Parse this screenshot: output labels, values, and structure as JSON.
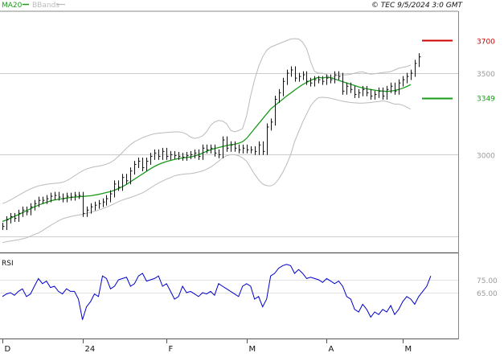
{
  "header": {
    "legend_ma": "MA20",
    "legend_bb": "BBands",
    "copyright": "© TEC 9/5/2024 3:0 GMT"
  },
  "colors": {
    "ma": "#1a9a1a",
    "bbands": "#bbbbbb",
    "rsi": "#0000cc",
    "price": "#111111",
    "target_high": "#cc0000",
    "target_low": "#1a9a1a",
    "grid": "#cccccc"
  },
  "chart_data": [
    {
      "type": "ohlc",
      "axis_ticks": [
        {
          "value": 3700,
          "label": "3700",
          "color": "#cc0000"
        },
        {
          "value": 3500,
          "label": "3500"
        },
        {
          "value": 3349,
          "label": "3349",
          "color": "#1a9a1a"
        },
        {
          "value": 3000,
          "label": "3000"
        }
      ],
      "grid_levels": [
        3500,
        3000,
        2500
      ],
      "ylim": [
        2400,
        3880
      ],
      "x_labels": [
        {
          "label": "D",
          "index": 0
        },
        {
          "label": "24",
          "index": 20
        },
        {
          "label": "F",
          "index": 41
        },
        {
          "label": "M",
          "index": 61
        },
        {
          "label": "A",
          "index": 81
        },
        {
          "label": "M",
          "index": 100
        }
      ],
      "series": [
        {
          "name": "MA20",
          "values": [
            2590,
            2600,
            2610,
            2622,
            2632,
            2644,
            2656,
            2668,
            2680,
            2690,
            2700,
            2708,
            2716,
            2722,
            2726,
            2730,
            2734,
            2738,
            2740,
            2742,
            2744,
            2746,
            2748,
            2752,
            2756,
            2762,
            2768,
            2774,
            2782,
            2792,
            2804,
            2818,
            2834,
            2850,
            2866,
            2882,
            2898,
            2914,
            2928,
            2940,
            2950,
            2958,
            2965,
            2971,
            2976,
            2980,
            2983,
            2986,
            2992,
            3000,
            3010,
            3020,
            3030,
            3038,
            3044,
            3050,
            3056,
            3060,
            3064,
            3070,
            3080,
            3100,
            3130,
            3160,
            3190,
            3220,
            3250,
            3280,
            3300,
            3320,
            3340,
            3360,
            3378,
            3396,
            3414,
            3430,
            3444,
            3456,
            3466,
            3475,
            3470,
            3476,
            3472,
            3464,
            3456,
            3448,
            3440,
            3432,
            3424,
            3416,
            3410,
            3404,
            3400,
            3396,
            3392,
            3390,
            3388,
            3390,
            3394,
            3400,
            3408,
            3418,
            3430
          ]
        },
        {
          "name": "BB Upper",
          "values": [
            2700,
            2710,
            2722,
            2736,
            2750,
            2764,
            2778,
            2790,
            2800,
            2808,
            2814,
            2818,
            2822,
            2824,
            2826,
            2830,
            2840,
            2854,
            2870,
            2886,
            2900,
            2912,
            2920,
            2926,
            2930,
            2935,
            2942,
            2952,
            2968,
            2990,
            3014,
            3040,
            3062,
            3080,
            3092,
            3104,
            3114,
            3122,
            3128,
            3132,
            3134,
            3136,
            3138,
            3140,
            3140,
            3136,
            3126,
            3108,
            3100,
            3104,
            3116,
            3140,
            3180,
            3200,
            3210,
            3206,
            3190,
            3150,
            3140,
            3148,
            3160,
            3240,
            3360,
            3460,
            3540,
            3600,
            3640,
            3660,
            3670,
            3680,
            3690,
            3700,
            3710,
            3712,
            3710,
            3690,
            3650,
            3570,
            3510,
            3500,
            3500,
            3490,
            3470,
            3480,
            3490,
            3490,
            3490,
            3494,
            3500,
            3506,
            3508,
            3500,
            3494,
            3496,
            3500,
            3504,
            3506,
            3510,
            3520,
            3530,
            3536,
            3540,
            3550
          ]
        },
        {
          "name": "BB Lower",
          "values": [
            2460,
            2466,
            2470,
            2474,
            2478,
            2484,
            2490,
            2500,
            2510,
            2520,
            2534,
            2550,
            2566,
            2580,
            2594,
            2606,
            2614,
            2620,
            2626,
            2630,
            2634,
            2640,
            2646,
            2652,
            2660,
            2668,
            2678,
            2688,
            2700,
            2712,
            2722,
            2730,
            2738,
            2746,
            2756,
            2766,
            2780,
            2796,
            2812,
            2826,
            2838,
            2850,
            2860,
            2870,
            2876,
            2880,
            2882,
            2884,
            2888,
            2894,
            2900,
            2910,
            2924,
            2940,
            2960,
            2980,
            2994,
            3000,
            3000,
            2994,
            2980,
            2960,
            2920,
            2880,
            2846,
            2820,
            2810,
            2808,
            2820,
            2850,
            2890,
            2940,
            3000,
            3080,
            3140,
            3200,
            3250,
            3300,
            3330,
            3350,
            3352,
            3350,
            3346,
            3340,
            3334,
            3328,
            3324,
            3320,
            3318,
            3316,
            3316,
            3318,
            3320,
            3324,
            3326,
            3330,
            3326,
            3318,
            3310,
            3310,
            3304,
            3292,
            3278
          ]
        },
        {
          "name": "Price",
          "values": [
            2560,
            2600,
            2620,
            2610,
            2640,
            2660,
            2650,
            2680,
            2700,
            2720,
            2720,
            2730,
            2745,
            2750,
            2740,
            2730,
            2745,
            2740,
            2750,
            2750,
            2640,
            2660,
            2680,
            2690,
            2700,
            2710,
            2730,
            2760,
            2820,
            2800,
            2860,
            2840,
            2900,
            2940,
            2960,
            2920,
            2960,
            2990,
            3010,
            2990,
            3020,
            2990,
            3000,
            2995,
            2990,
            2985,
            2995,
            3000,
            3010,
            2990,
            3040,
            3030,
            3040,
            3010,
            3000,
            3090,
            3040,
            3060,
            3040,
            3030,
            3040,
            3030,
            3030,
            3020,
            3060,
            3020,
            3170,
            3200,
            3340,
            3380,
            3450,
            3500,
            3520,
            3470,
            3480,
            3490,
            3450,
            3440,
            3460,
            3460,
            3450,
            3470,
            3460,
            3490,
            3480,
            3390,
            3420,
            3400,
            3370,
            3380,
            3400,
            3380,
            3360,
            3370,
            3390,
            3360,
            3400,
            3420,
            3390,
            3440,
            3460,
            3480,
            3500,
            3560,
            3600
          ]
        }
      ],
      "target_lines": [
        {
          "value": 3700,
          "label": "3700",
          "color": "#cc0000"
        },
        {
          "value": 3349,
          "label": "3349",
          "color": "#1a9a1a"
        }
      ]
    },
    {
      "type": "line",
      "title": "RSI",
      "ylim": [
        30,
        95
      ],
      "axis_ticks": [
        {
          "value": 75,
          "label": "75.00"
        },
        {
          "value": 65,
          "label": "65.00"
        }
      ],
      "series": [
        {
          "name": "RSI",
          "values": [
            62,
            64,
            65,
            63,
            66,
            68,
            62,
            64,
            70,
            76,
            72,
            74,
            69,
            70,
            66,
            64,
            68,
            66,
            66,
            60,
            44,
            54,
            58,
            64,
            62,
            78,
            76,
            68,
            70,
            75,
            76,
            77,
            70,
            72,
            78,
            80,
            74,
            75,
            76,
            78,
            70,
            72,
            66,
            60,
            62,
            70,
            65,
            66,
            64,
            62,
            65,
            64,
            66,
            63,
            72,
            70,
            68,
            66,
            64,
            62,
            70,
            72,
            70,
            60,
            62,
            54,
            60,
            78,
            80,
            84,
            86,
            87,
            86,
            80,
            83,
            80,
            76,
            77,
            76,
            75,
            73,
            76,
            74,
            72,
            74,
            70,
            62,
            60,
            52,
            50,
            56,
            52,
            46,
            50,
            48,
            52,
            50,
            55,
            48,
            52,
            58,
            62,
            60,
            56,
            62,
            66,
            70,
            78
          ]
        }
      ]
    }
  ]
}
